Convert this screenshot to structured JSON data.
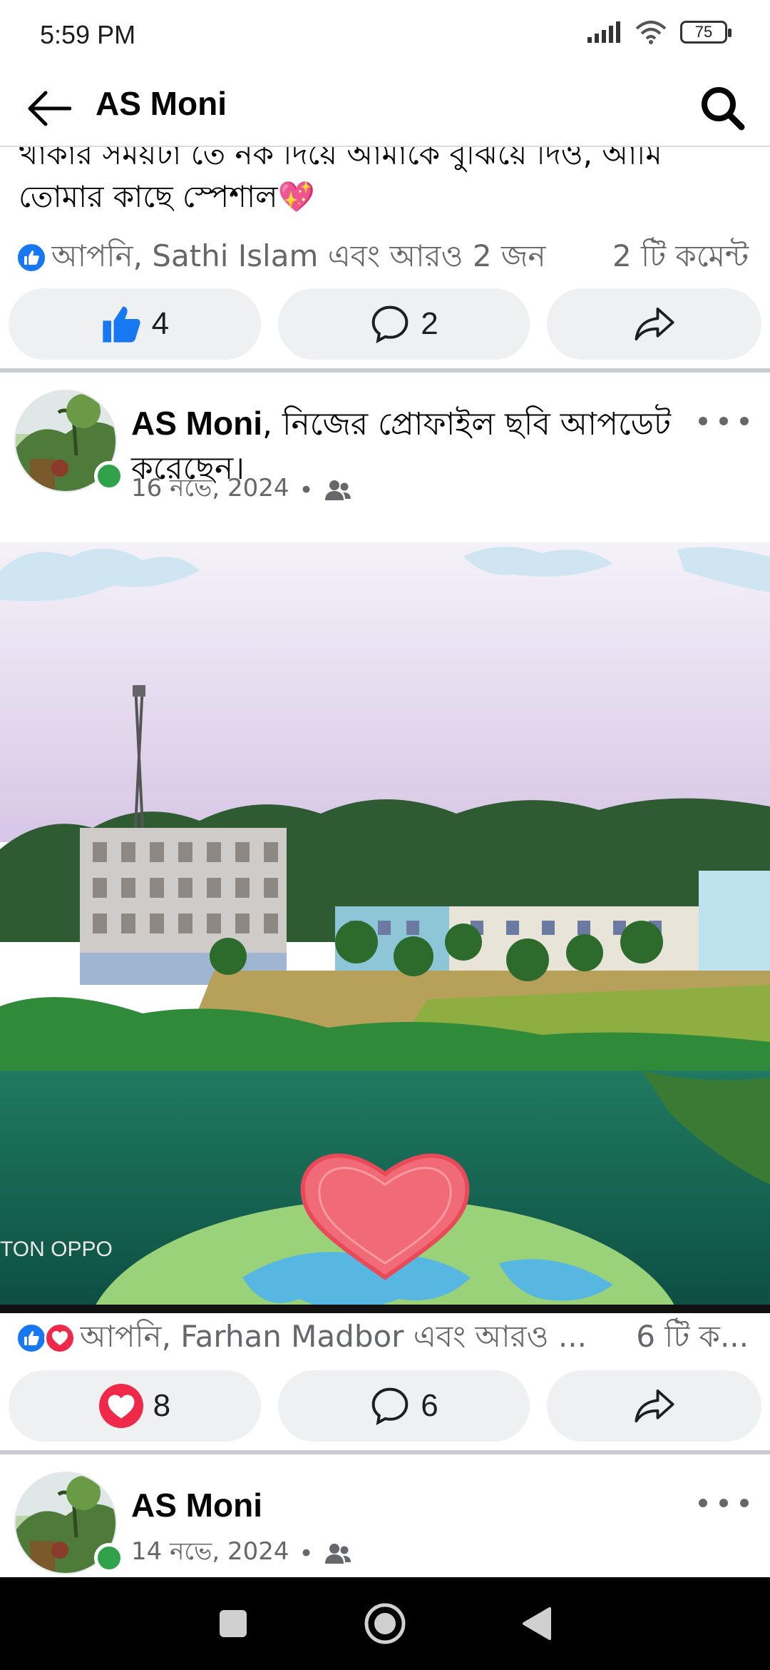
{
  "status_bar": {
    "time": "5:59 PM",
    "battery": "75"
  },
  "header": {
    "title": "AS Moni"
  },
  "prev_post": {
    "text_line1": "থাকার সময়টা তে নক দিয়ে আমাকে বুঝিয়ে দিও, আমি",
    "text_line2": "তোমার কাছে স্পেশাল💖",
    "reactions_summary": "আপনি, Sathi Islam এবং আরও 2 জন",
    "comment_count": "2 টি কমেন্ট",
    "like_count": "4",
    "comment_button_count": "2"
  },
  "post1": {
    "author": "AS Moni",
    "action_text": ", নিজের প্রোফাইল ছবি আপডেট করেছেন।",
    "date": "16 নভে, 2024",
    "dot": "•",
    "watermark": "TON OPPO",
    "reactions_summary": "আপনি, Farhan Madbor এবং আরও ...",
    "comment_count": "6 টি ক...",
    "love_count": "8",
    "comment_button_count": "6"
  },
  "post2": {
    "author": "AS Moni",
    "date": "14 নভে, 2024",
    "dot": "•"
  },
  "colors": {
    "facebook_blue": "#1877f2",
    "love_red": "#f02849",
    "online_green": "#31a24c",
    "pill_bg": "#eff0f2"
  },
  "icons": [
    "back-arrow-icon",
    "search-icon",
    "like-icon",
    "love-icon",
    "comment-icon",
    "share-icon",
    "friends-icon",
    "more-icon"
  ]
}
